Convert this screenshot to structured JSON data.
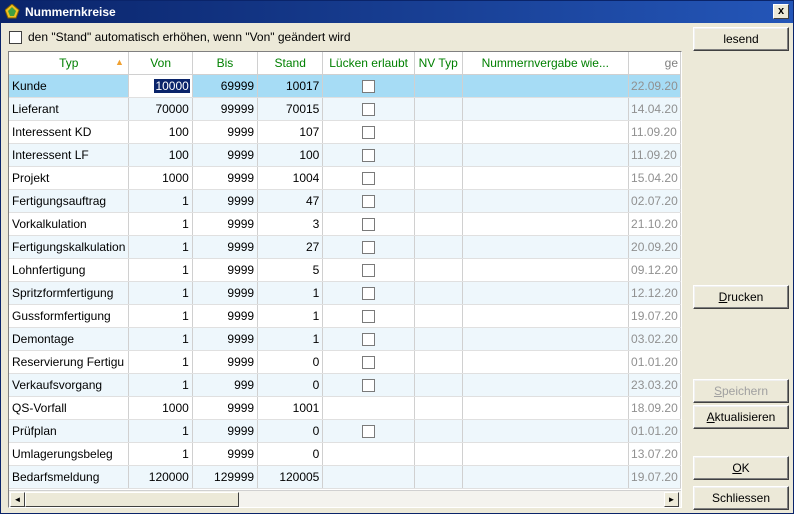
{
  "window": {
    "title": "Nummernkreise",
    "close_label": "x"
  },
  "option": {
    "label": "den \"Stand\" automatisch erhöhen, wenn \"Von\" geändert wird"
  },
  "buttons": {
    "lesend": "lesend",
    "drucken_u": "D",
    "drucken_rest": "rucken",
    "speichern_u": "S",
    "speichern_rest": "peichern",
    "aktualisieren_u": "A",
    "aktualisieren_rest": "ktualisieren",
    "ok_u": "O",
    "ok_rest": "K",
    "schliessen": "Schliessen"
  },
  "table": {
    "columns": [
      "Typ",
      "Von",
      "Bis",
      "Stand",
      "Lücken erlaubt",
      "NV Typ",
      "Nummernvergabe wie...",
      "ge"
    ],
    "sort_arrow": "▲",
    "rows": [
      {
        "typ": "Kunde",
        "von": "10000",
        "bis": "69999",
        "stand": "10017",
        "cb": true,
        "date": "22.09.20"
      },
      {
        "typ": "Lieferant",
        "von": "70000",
        "bis": "99999",
        "stand": "70015",
        "cb": true,
        "date": "14.04.20"
      },
      {
        "typ": "Interessent KD",
        "von": "100",
        "bis": "9999",
        "stand": "107",
        "cb": true,
        "date": "11.09.20"
      },
      {
        "typ": "Interessent LF",
        "von": "100",
        "bis": "9999",
        "stand": "100",
        "cb": true,
        "date": "11.09.20"
      },
      {
        "typ": "Projekt",
        "von": "1000",
        "bis": "9999",
        "stand": "1004",
        "cb": true,
        "date": "15.04.20"
      },
      {
        "typ": "Fertigungsauftrag",
        "von": "1",
        "bis": "9999",
        "stand": "47",
        "cb": true,
        "date": "02.07.20"
      },
      {
        "typ": "Vorkalkulation",
        "von": "1",
        "bis": "9999",
        "stand": "3",
        "cb": true,
        "date": "21.10.20"
      },
      {
        "typ": "Fertigungskalkulation",
        "von": "1",
        "bis": "9999",
        "stand": "27",
        "cb": true,
        "date": "20.09.20"
      },
      {
        "typ": "Lohnfertigung",
        "von": "1",
        "bis": "9999",
        "stand": "5",
        "cb": true,
        "date": "09.12.20"
      },
      {
        "typ": "Spritzformfertigung",
        "von": "1",
        "bis": "9999",
        "stand": "1",
        "cb": true,
        "date": "12.12.20"
      },
      {
        "typ": "Gussformfertigung",
        "von": "1",
        "bis": "9999",
        "stand": "1",
        "cb": true,
        "date": "19.07.20"
      },
      {
        "typ": "Demontage",
        "von": "1",
        "bis": "9999",
        "stand": "1",
        "cb": true,
        "date": "03.02.20"
      },
      {
        "typ": "Reservierung Fertigu",
        "von": "1",
        "bis": "9999",
        "stand": "0",
        "cb": true,
        "date": "01.01.20"
      },
      {
        "typ": "Verkaufsvorgang",
        "von": "1",
        "bis": "999",
        "stand": "0",
        "cb": true,
        "date": "23.03.20"
      },
      {
        "typ": "QS-Vorfall",
        "von": "1000",
        "bis": "9999",
        "stand": "1001",
        "cb": false,
        "date": "18.09.20"
      },
      {
        "typ": "Prüfplan",
        "von": "1",
        "bis": "9999",
        "stand": "0",
        "cb": true,
        "date": "01.01.20"
      },
      {
        "typ": "Umlagerungsbeleg",
        "von": "1",
        "bis": "9999",
        "stand": "0",
        "cb": false,
        "date": "13.07.20"
      },
      {
        "typ": "Bedarfsmeldung",
        "von": "120000",
        "bis": "129999",
        "stand": "120005",
        "cb": false,
        "date": "19.07.20"
      }
    ]
  },
  "scrollbar": {
    "left_arrow": "◄",
    "right_arrow": "►"
  }
}
